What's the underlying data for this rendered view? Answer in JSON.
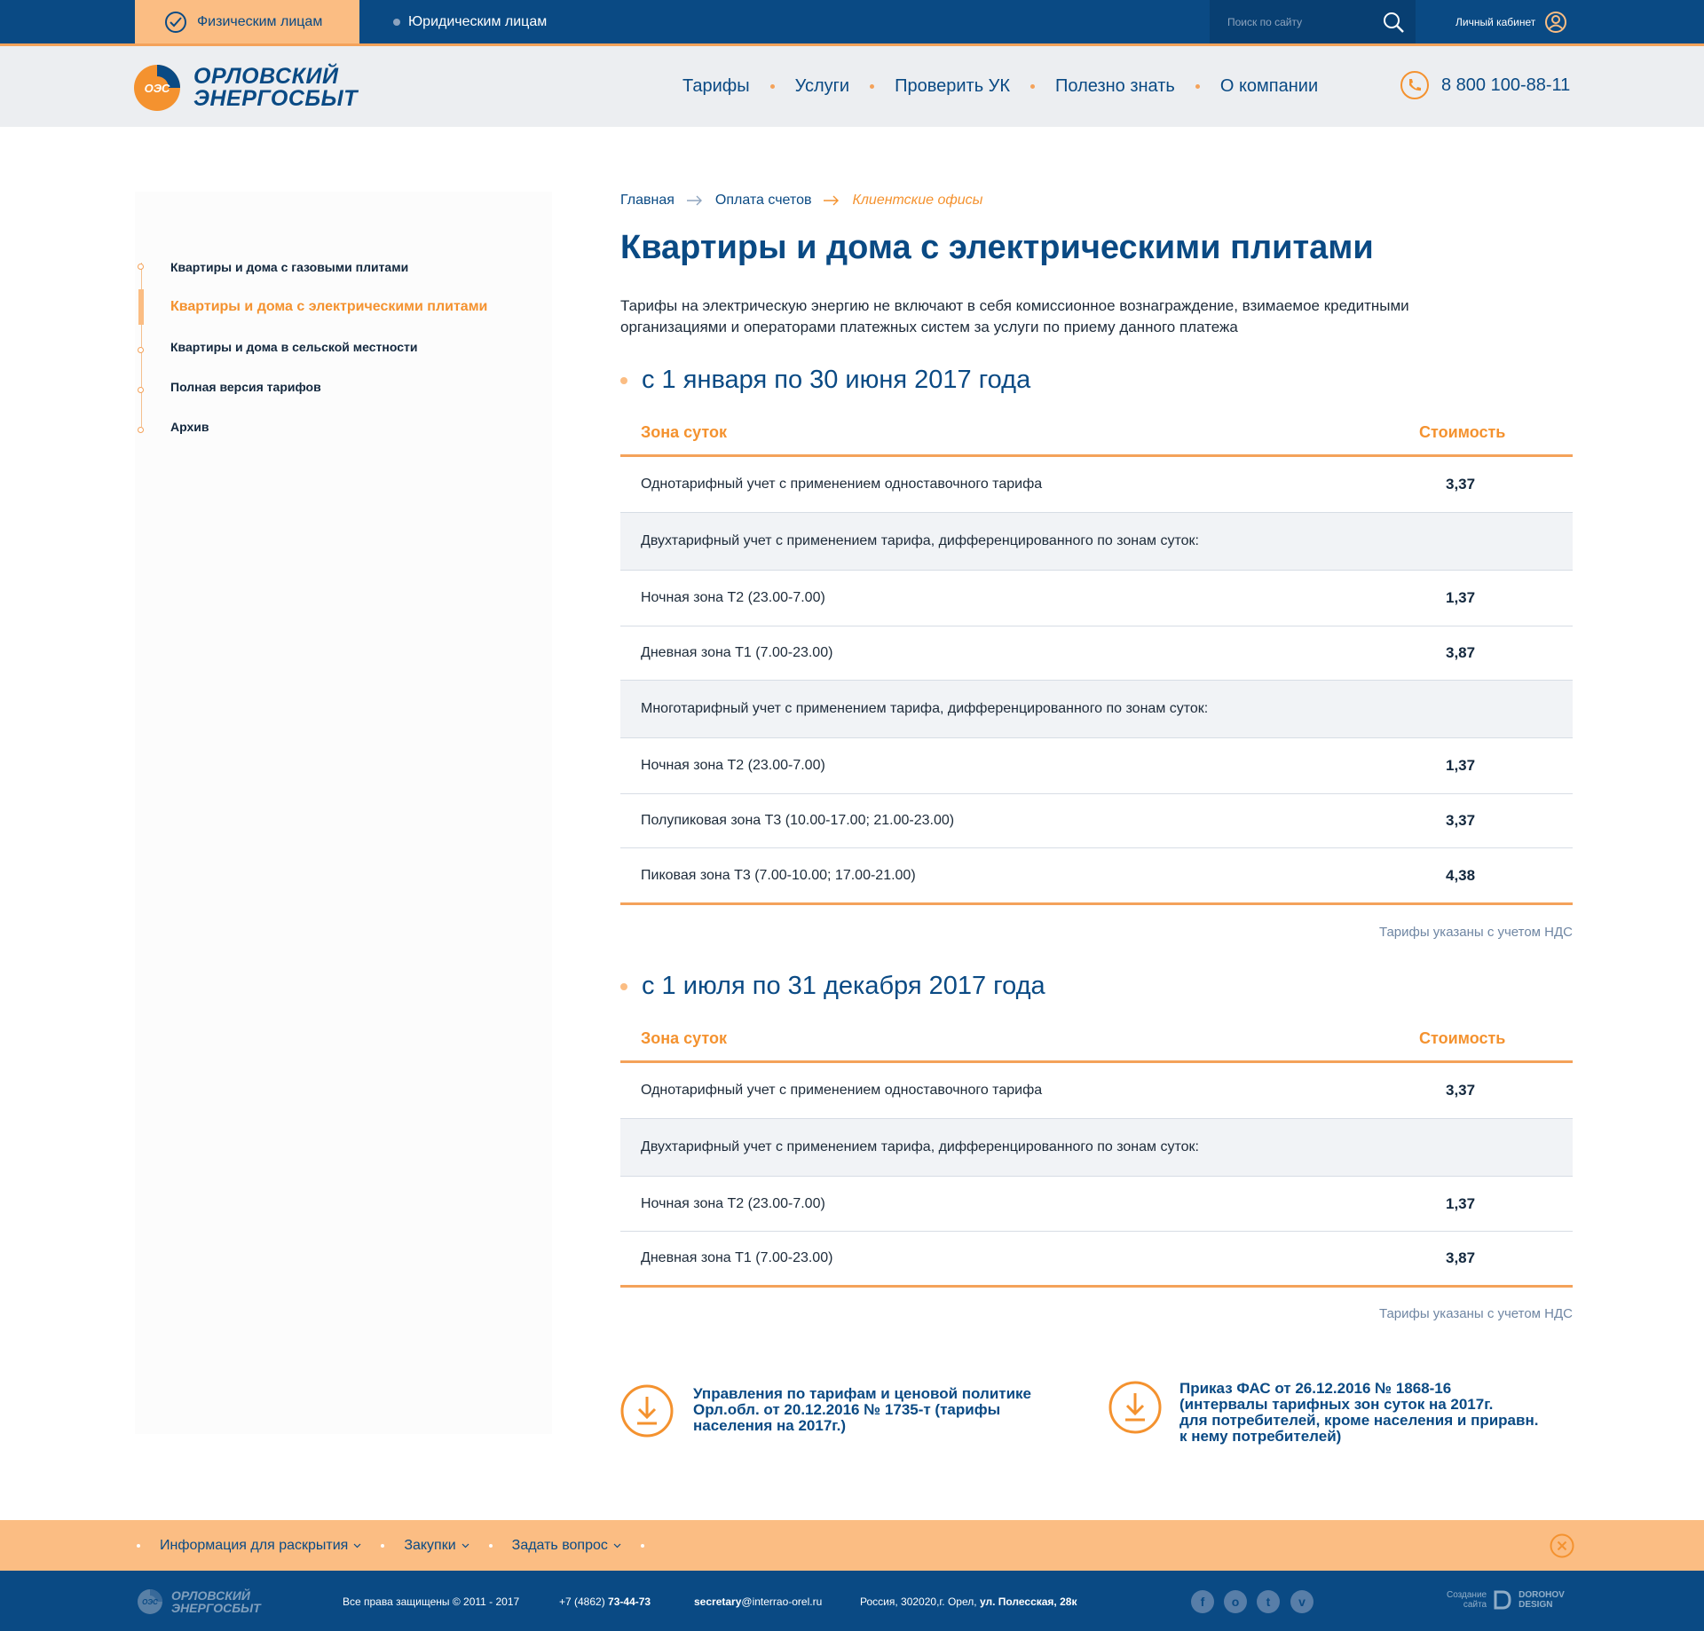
{
  "topbar": {
    "audience_active": "Физическим лицам",
    "audience_other": "Юридическим лицам",
    "search_placeholder": "Поиск по сайту",
    "cabinet": "Личный кабинет"
  },
  "header": {
    "logo_mark": "ОЭС",
    "logo_line1": "ОРЛОВСКИЙ",
    "logo_line2": "ЭНЕРГОСБЫТ",
    "nav": [
      "Тарифы",
      "Услуги",
      "Проверить УК",
      "Полезно знать",
      "О компании"
    ],
    "phone": "8 800 100-88-11"
  },
  "sidebar": {
    "items": [
      "Квартиры и дома с газовыми плитами",
      "Квартиры и дома с электрическими плитами",
      "Квартиры и дома в сельской местности",
      "Полная версия тарифов",
      "Архив"
    ],
    "active_index": 1
  },
  "breadcrumbs": [
    "Главная",
    "Оплата счетов",
    "Клиентские офисы"
  ],
  "page": {
    "title": "Квартиры и дома с электрическими плитами",
    "intro": "Тарифы на электрическую энергию не включают в себя комиссионное вознаграждение, взимаемое кредитными организациями и операторами платежных систем за услуги по приему данного платежа"
  },
  "table_headers": {
    "zone": "Зона суток",
    "cost": "Стоимость"
  },
  "vat_note": "Тарифы указаны с учетом НДС",
  "periods": [
    {
      "title": "с 1 января по 30 июня 2017 года",
      "rows": [
        {
          "name": "Однотарифный учет с применением одноставочного тарифа",
          "value": "3,37"
        },
        {
          "name": "Двухтарифный учет с применением тарифа, дифференцированного по зонам суток:",
          "value": ""
        },
        {
          "name": "Ночная зона Т2  (23.00-7.00)",
          "value": "1,37"
        },
        {
          "name": "Дневная зона Т1  (7.00-23.00)",
          "value": "3,87"
        },
        {
          "name": "Многотарифный учет с применением тарифа, дифференцированного по зонам суток:",
          "value": ""
        },
        {
          "name": "Ночная зона Т2  (23.00-7.00)",
          "value": "1,37"
        },
        {
          "name": "Полупиковая зона Т3  (10.00-17.00; 21.00-23.00)",
          "value": "3,37"
        },
        {
          "name": "Пиковая зона Т3  (7.00-10.00; 17.00-21.00)",
          "value": "4,38"
        }
      ]
    },
    {
      "title": "с 1 июля по 31 декабря 2017 года",
      "rows": [
        {
          "name": "Однотарифный учет с применением одноставочного тарифа",
          "value": "3,37"
        },
        {
          "name": "Двухтарифный учет с применением тарифа, дифференцированного по зонам суток:",
          "value": ""
        },
        {
          "name": "Ночная зона Т2  (23.00-7.00)",
          "value": "1,37"
        },
        {
          "name": "Дневная зона Т1  (7.00-23.00)",
          "value": "3,87"
        }
      ]
    }
  ],
  "documents": [
    {
      "lines": [
        "Управления по тарифам и ценовой политике",
        "Орл.обл. от 20.12.2016 № 1735-т (тарифы",
        "населения на 2017г.)"
      ]
    },
    {
      "lines": [
        "Приказ ФАС от 26.12.2016 № 1868-16",
        "(интервалы тарифных зон суток на 2017г.",
        "для потребителей, кроме населения и приравн.",
        "к нему потребителей)"
      ]
    }
  ],
  "footer": {
    "nav": [
      "Информация для раскрытия",
      "Закупки",
      "Задать вопрос"
    ],
    "copyright": "Все права защищены © 2011 - 2017",
    "phone_prefix": "+7 (4862)",
    "phone_number": "73-44-73",
    "email_user": "secretary",
    "email_domain": "@interrao-orel.ru",
    "address_prefix": "Россия, 302020,г. Орел,",
    "address_street": "ул. Полесская, 28к",
    "made_line1": "Создание",
    "made_line2": "сайта",
    "made_brand1": "DOROHOV",
    "made_brand2": "DESIGN",
    "social": [
      "facebook-icon",
      "odnoklassniki-icon",
      "twitter-icon",
      "vk-icon"
    ]
  },
  "colors": {
    "brand_blue": "#0a4a84",
    "accent_orange": "#f4922f",
    "accent_light": "#fbbd83"
  }
}
